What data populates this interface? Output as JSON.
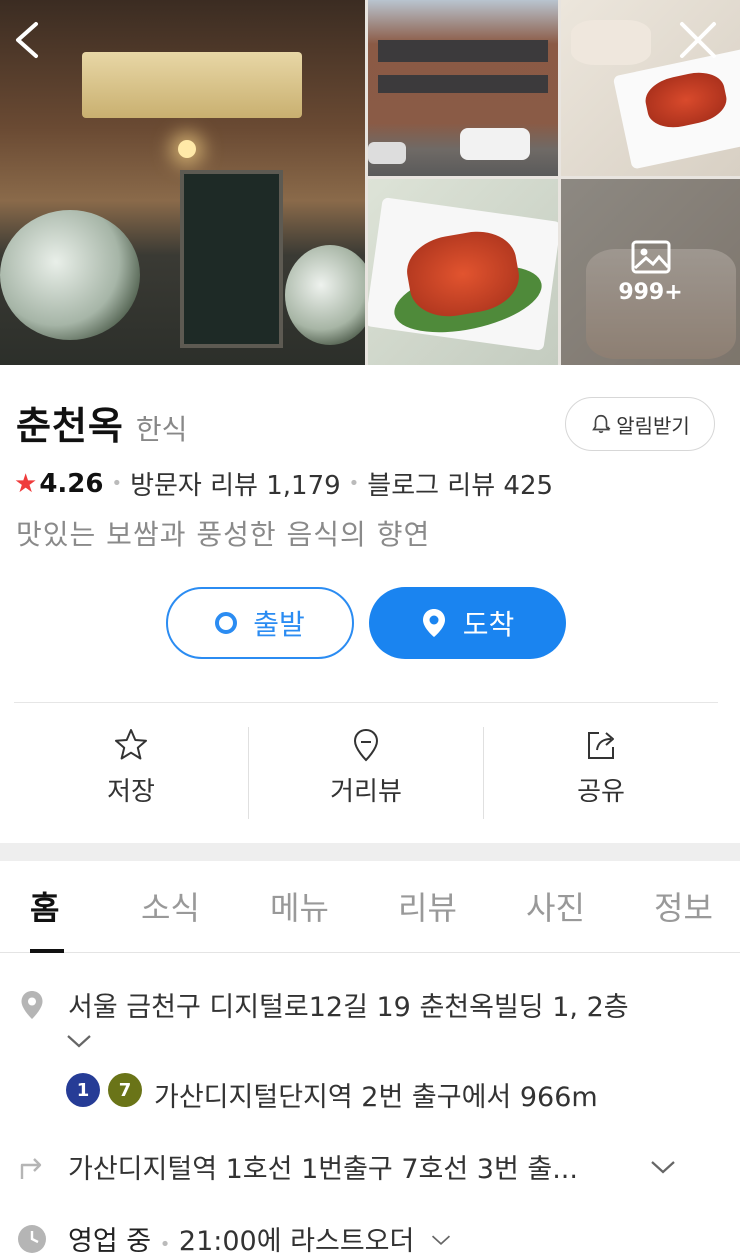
{
  "gallery": {
    "more_count": "999+"
  },
  "place": {
    "name": "춘천옥",
    "category": "한식",
    "alarm_label": "알림받기",
    "rating": "4.26",
    "visitor_review_label": "방문자 리뷰 1,179",
    "blog_review_label": "블로그 리뷰 425",
    "tagline": "맛있는 보쌈과 풍성한 음식의 향연"
  },
  "route": {
    "departure_label": "출발",
    "arrival_label": "도착"
  },
  "actions": {
    "save_label": "저장",
    "street_view_label": "거리뷰",
    "share_label": "공유"
  },
  "tabs": [
    {
      "label": "홈",
      "active": true
    },
    {
      "label": "소식"
    },
    {
      "label": "메뉴"
    },
    {
      "label": "리뷰"
    },
    {
      "label": "사진"
    },
    {
      "label": "정보"
    }
  ],
  "details": {
    "address": "서울 금천구 디지털로12길 19 춘천옥빌딩 1, 2층",
    "subway_lines": [
      {
        "number": "1",
        "color": "#263c96"
      },
      {
        "number": "7",
        "color": "#6a7418"
      }
    ],
    "subway_text": "가산디지털단지역 2번 출구에서 966m",
    "directions": "가산디지털역 1호선 1번출구 7호선 3번 출...",
    "hours_status": "영업 중",
    "hours_text": "21:00에 라스트오더"
  },
  "colors": {
    "primary_blue": "#1a84f0",
    "star_red": "#ef3b3b"
  }
}
